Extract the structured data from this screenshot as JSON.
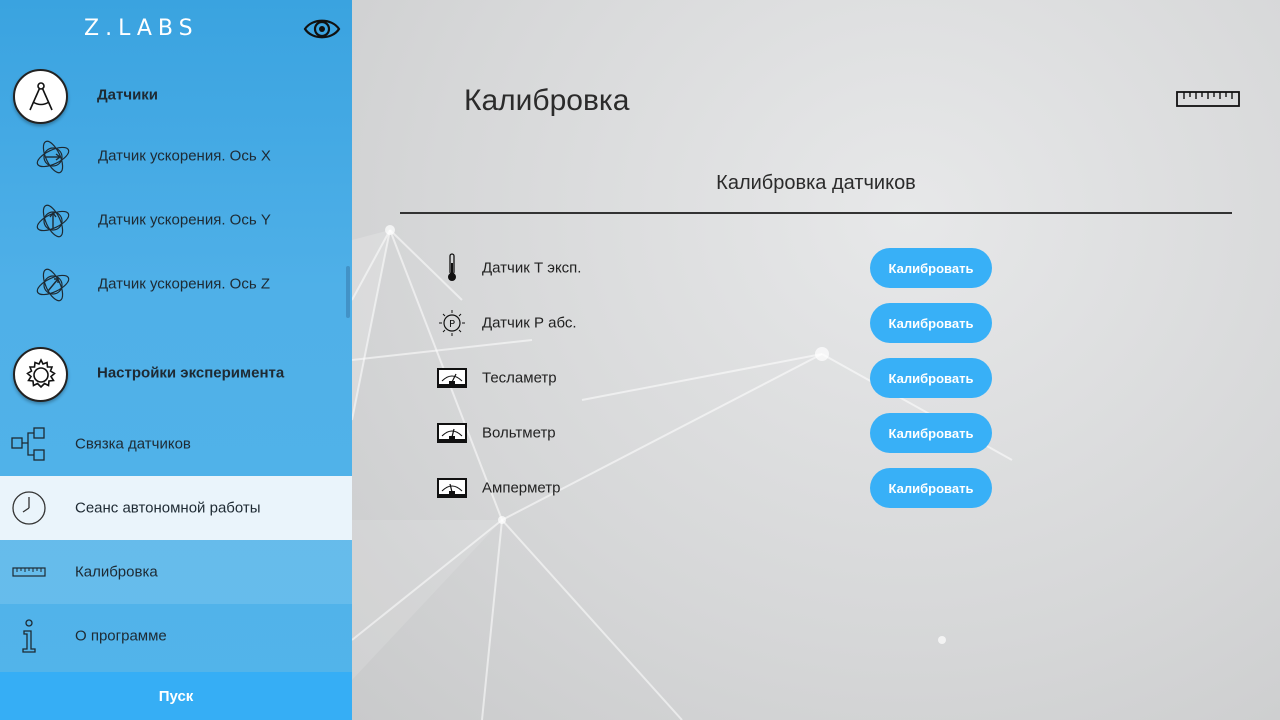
{
  "app": {
    "logo": "Z.LABS"
  },
  "sidebar": {
    "sections": [
      {
        "title": "Датчики",
        "items": [
          {
            "label": "Датчик ускорения. Ось X"
          },
          {
            "label": "Датчик ускорения. Ось Y"
          },
          {
            "label": "Датчик ускорения. Ось Z"
          }
        ]
      },
      {
        "title": "Настройки эксперимента"
      }
    ],
    "nav": [
      {
        "label": "Связка датчиков",
        "icon": "flowchart-icon"
      },
      {
        "label": "Сеанс автономной работы",
        "icon": "clock-icon"
      },
      {
        "label": "Калибровка",
        "icon": "ruler-icon"
      },
      {
        "label": "О программе",
        "icon": "info-icon"
      }
    ],
    "start_label": "Пуск"
  },
  "main": {
    "title": "Калибровка",
    "section_title": "Калибровка датчиков",
    "rows": [
      {
        "label": "Датчик Т эксп.",
        "icon": "thermometer-icon",
        "button": "Калибровать"
      },
      {
        "label": "Датчик Р абс.",
        "icon": "pressure-gauge-icon",
        "button": "Калибровать"
      },
      {
        "label": "Тесламетр",
        "icon": "teslameter-icon",
        "button": "Калибровать"
      },
      {
        "label": "Вольтметр",
        "icon": "voltmeter-icon",
        "button": "Калибровать"
      },
      {
        "label": "Амперметр",
        "icon": "ammeter-icon",
        "button": "Калибровать"
      }
    ]
  },
  "colors": {
    "sidebar_bg": "#4fb0e8",
    "accent": "#38b0f7",
    "start_button": "#36aef5",
    "active_row": "#eaf4fb"
  }
}
